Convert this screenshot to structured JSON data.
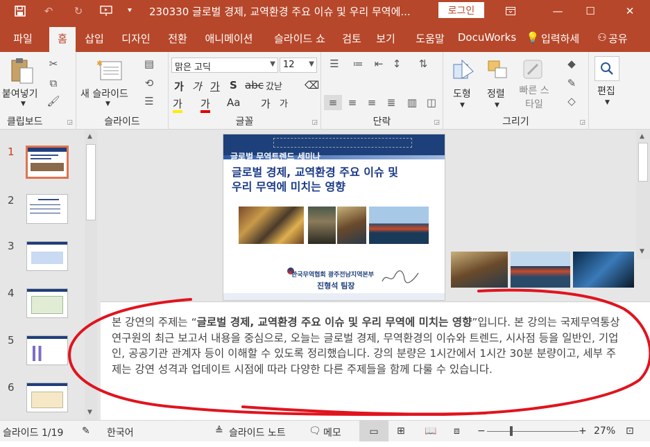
{
  "titlebar": {
    "doc_title": "230330 글로벌 경제, 교역환경 주요 이슈 및 우리 무역에...",
    "login_label": "로그인",
    "icons": [
      "save-icon",
      "undo-icon",
      "redo-icon",
      "present-icon",
      "customize-icon"
    ]
  },
  "tabs": [
    {
      "label": "파일"
    },
    {
      "label": "홈"
    },
    {
      "label": "삽입"
    },
    {
      "label": "디자인"
    },
    {
      "label": "전환"
    },
    {
      "label": "애니메이션"
    },
    {
      "label": "슬라이드 쇼"
    },
    {
      "label": "검토"
    },
    {
      "label": "보기"
    },
    {
      "label": "도움말"
    },
    {
      "label": "DocuWorks"
    },
    {
      "label": "입력하세"
    },
    {
      "label": "공유"
    }
  ],
  "ribbon": {
    "clipboard": {
      "paste_label": "붙여넣기",
      "group_label": "클립보드"
    },
    "slides": {
      "new_slide_label": "새 슬라이드",
      "group_label": "슬라이드"
    },
    "font": {
      "font_name": "맑은 고딕",
      "font_size": "12",
      "group_label": "글꼴",
      "bold": "가",
      "italic": "가",
      "underline": "가",
      "strike": "S",
      "spacing": "갔낟",
      "highlight": "가",
      "color": "가",
      "case": "Aa",
      "grow": "가",
      "shrink": "가"
    },
    "paragraph": {
      "group_label": "단락"
    },
    "drawing": {
      "shapes_label": "도형",
      "arrange_label": "정렬",
      "quick_style_label": "빠른 스타일",
      "group_label": "그리기"
    },
    "editing": {
      "edit_label": "편집"
    }
  },
  "thumbnails": [
    {
      "num": "1"
    },
    {
      "num": "2"
    },
    {
      "num": "3"
    },
    {
      "num": "4"
    },
    {
      "num": "5"
    },
    {
      "num": "6"
    }
  ],
  "slide": {
    "subtitle": "글로벌 무역트렌드 세미나",
    "title_line1": "글로벌 경제, 교역환경 주요 이슈 및",
    "title_line2": "우리 무역에 미치는 영향",
    "org": "한국무역협회 광주전남지역본부",
    "presenter": "진형석 팀장"
  },
  "notes": {
    "p1": "본 강연의 주제는 “",
    "p1_bold": "글로벌 경제, 교역환경 주요 이슈 및 우리 무역에 미치는 영향",
    "p1_end": "”입니다.",
    "p2": "본 강의는 국제무역통상연구원의 최근 보고서 내용을 중심으로, 오늘는 글로벌 경제, 무역환경의 이슈와 트렌드, 시사점 등을 일반인, 기업인, 공공기관 관계자 등이 이해할 수 있도록 정리했습니다. 강의 분량은 1시간에서 1시간 30분 분량이고, 세부 주제는 강연 성격과 업데이트 시점에 따라 다양한 다른 주제들을 함께 다룰 수 있습니다."
  },
  "statusbar": {
    "slide_info": "슬라이드 1/19",
    "language": "한국어",
    "notes_label": "슬라이드 노트",
    "comments_label": "메모",
    "zoom": "27%"
  },
  "colors": {
    "accent": "#b7472a",
    "annotation": "#e0141e"
  }
}
